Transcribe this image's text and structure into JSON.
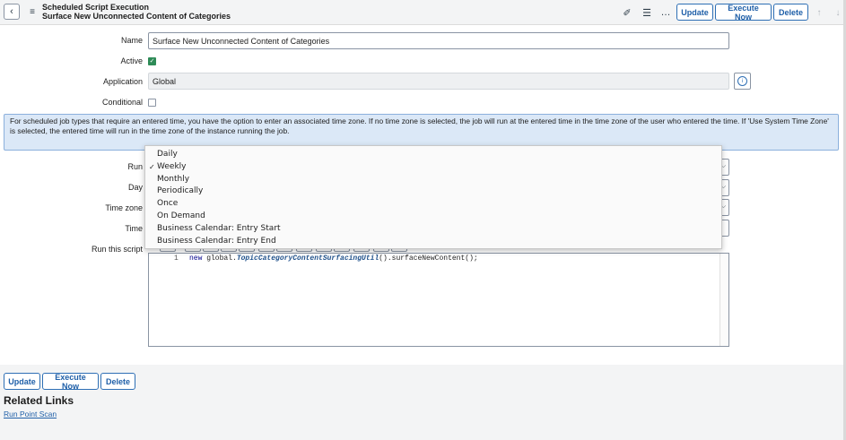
{
  "header": {
    "breadcrumb": "Scheduled Script Execution",
    "record_title": "Surface New Unconnected Content of Categories",
    "buttons": {
      "update": "Update",
      "execute_now": "Execute Now",
      "delete": "Delete"
    },
    "icons": [
      "back-icon",
      "menu-icon",
      "attachment-icon",
      "settings-sliders-icon",
      "more-icon",
      "arrow-up-icon",
      "arrow-down-icon"
    ]
  },
  "form": {
    "name_label": "Name",
    "name_value": "Surface New Unconnected Content of Categories",
    "active_label": "Active",
    "active_checked": true,
    "application_label": "Application",
    "application_value": "Global",
    "conditional_label": "Conditional",
    "conditional_checked": false,
    "notice": "For scheduled job types that require an entered time, you have the option to enter an associated time zone. If no time zone is selected, the job will run at the entered time in the time zone of the user who entered the time. If 'Use System Time Zone' is selected, the entered time will run in the time zone of the instance running the job.",
    "run_label": "Run",
    "day_label": "Day",
    "time_zone_label": "Time zone",
    "time_label": "Time",
    "script_label": "Run this script",
    "script": {
      "line_number": "1",
      "keyword": "new",
      "prefix": " global.",
      "class_name": "TopicCategoryContentSurfacingUtil",
      "suffix": "().surfaceNewContent();"
    }
  },
  "run_dropdown": {
    "selected": "Weekly",
    "options": [
      "Daily",
      "Weekly",
      "Monthly",
      "Periodically",
      "Once",
      "On Demand",
      "Business Calendar: Entry Start",
      "Business Calendar: Entry End"
    ]
  },
  "footer": {
    "buttons": {
      "update": "Update",
      "execute_now": "Execute Now",
      "delete": "Delete"
    },
    "related_links_title": "Related Links",
    "related_link": "Run Point Scan"
  },
  "colors": {
    "accent": "#1f5fa8",
    "header_bg": "#f3f4f5",
    "notice_bg": "#dbe8f7",
    "checkbox_on": "#2e8b57"
  }
}
